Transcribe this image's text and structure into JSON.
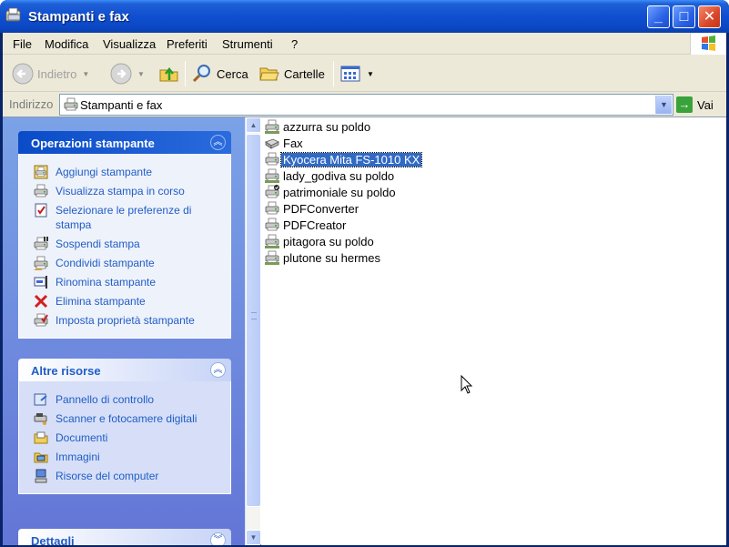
{
  "window": {
    "title": "Stampanti e fax"
  },
  "menu": [
    "File",
    "Modifica",
    "Visualizza",
    "Preferiti",
    "Strumenti",
    "?"
  ],
  "toolbar": {
    "back": "Indietro",
    "search": "Cerca",
    "folders": "Cartelle"
  },
  "address": {
    "label": "Indirizzo",
    "value": "Stampanti e fax",
    "go": "Vai"
  },
  "tasks": {
    "printer_ops": {
      "title": "Operazioni stampante",
      "items": [
        {
          "label": "Aggiungi stampante",
          "icon": "add-printer-icon"
        },
        {
          "label": "Visualizza stampa in corso",
          "icon": "print-queue-icon"
        },
        {
          "label": "Selezionare le preferenze di stampa",
          "icon": "print-preferences-icon"
        },
        {
          "label": "Sospendi stampa",
          "icon": "pause-printer-icon"
        },
        {
          "label": "Condividi stampante",
          "icon": "share-printer-icon"
        },
        {
          "label": "Rinomina stampante",
          "icon": "rename-icon"
        },
        {
          "label": "Elimina stampante",
          "icon": "delete-icon"
        },
        {
          "label": "Imposta proprietà stampante",
          "icon": "printer-properties-icon"
        }
      ]
    },
    "other": {
      "title": "Altre risorse",
      "items": [
        {
          "label": "Pannello di controllo",
          "icon": "control-panel-icon"
        },
        {
          "label": "Scanner e fotocamere digitali",
          "icon": "scanner-icon"
        },
        {
          "label": "Documenti",
          "icon": "documents-folder-icon"
        },
        {
          "label": "Immagini",
          "icon": "pictures-folder-icon"
        },
        {
          "label": "Risorse del computer",
          "icon": "my-computer-icon"
        }
      ]
    },
    "details": {
      "title": "Dettagli"
    }
  },
  "files": [
    {
      "name": "azzurra su poldo",
      "type": "network-printer"
    },
    {
      "name": "Fax",
      "type": "fax"
    },
    {
      "name": "Kyocera Mita FS-1010 KX",
      "type": "printer",
      "selected": true
    },
    {
      "name": "lady_godiva su poldo",
      "type": "network-printer"
    },
    {
      "name": "patrimoniale su poldo",
      "type": "default-network-printer"
    },
    {
      "name": "PDFConverter",
      "type": "printer"
    },
    {
      "name": "PDFCreator",
      "type": "printer"
    },
    {
      "name": "pitagora su poldo",
      "type": "network-printer"
    },
    {
      "name": "plutone su hermes",
      "type": "network-printer"
    }
  ]
}
